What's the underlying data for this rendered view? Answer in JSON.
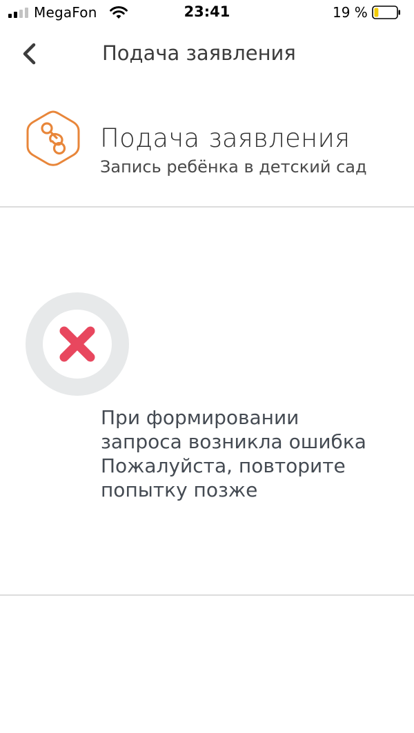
{
  "status_bar": {
    "carrier": "MegaFon",
    "time": "23:41",
    "battery_percent": "19 %",
    "battery_level": 0.19,
    "signal_bars_active": 2,
    "signal_bars_total": 4
  },
  "nav": {
    "title": "Подача заявления",
    "back_icon": "chevron-left-icon"
  },
  "service": {
    "icon": "pacifier-icon",
    "title": "Подача заявления",
    "subtitle": "Запись ребёнка в детский сад"
  },
  "error": {
    "icon": "close-icon",
    "lines": [
      "При формировании",
      "запроса возникла ошибка",
      "Пожалуйста, повторите",
      "попытку позже"
    ]
  },
  "colors": {
    "accent_orange": "#E8863A",
    "error_red": "#E8475E",
    "error_ring": "#E7E9EA"
  }
}
